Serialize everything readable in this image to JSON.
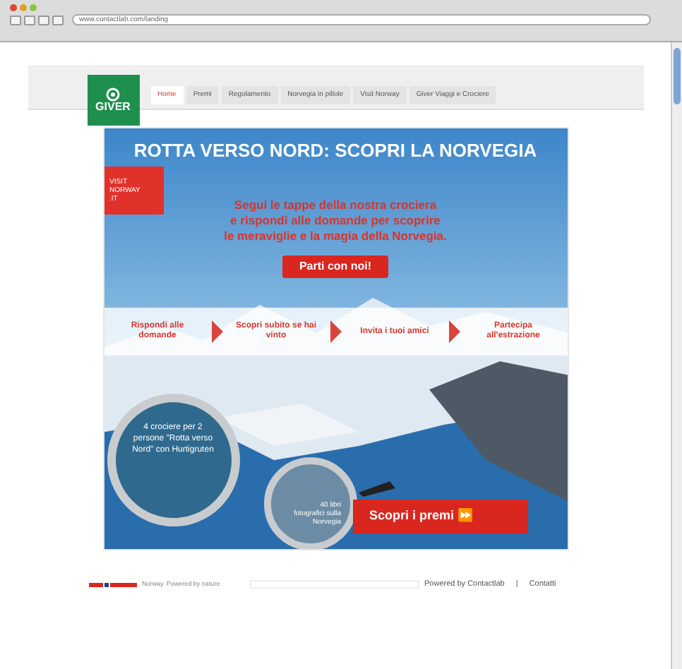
{
  "browser": {
    "url": "www.contactlab.com/landing"
  },
  "nav": {
    "logo": "GIVER",
    "tabs": [
      {
        "label": "Home",
        "selected": true
      },
      {
        "label": "Premi",
        "selected": false
      },
      {
        "label": "Regolamento",
        "selected": false
      },
      {
        "label": "Norvegia in pillole",
        "selected": false
      },
      {
        "label": "Visit Norway",
        "selected": false
      },
      {
        "label": "Giver Viaggi e Crociere",
        "selected": false
      }
    ]
  },
  "hero": {
    "title": "ROTTA VERSO NORD: SCOPRI LA NORVEGIA",
    "badge": [
      "VISIT",
      "NORWAY",
      ".IT"
    ],
    "intro": [
      "Segui le tappe della nostra crociera",
      "e rispondi alle domande per scoprire",
      "le meraviglie e la magia della Norvegia."
    ],
    "cta": "Parti con noi!",
    "steps": [
      {
        "label": "Rispondi alle domande"
      },
      {
        "label": "Scopri subito se hai vinto"
      },
      {
        "label": "Invita i tuoi amici"
      },
      {
        "label": "Partecipa all'estrazione"
      }
    ],
    "prize_main": "4 crociere per 2 persone \"Rotta verso Nord\" con Hurtigruten",
    "prize_second": "40 libri fotografici sulla Norvegia",
    "prizes_button": "Scopri i premi ⏩"
  },
  "footer": {
    "tagline": "Norway. Powered by nature.",
    "powered": "Powered by Contactlab",
    "separator": "|",
    "contact": "Contatti"
  }
}
